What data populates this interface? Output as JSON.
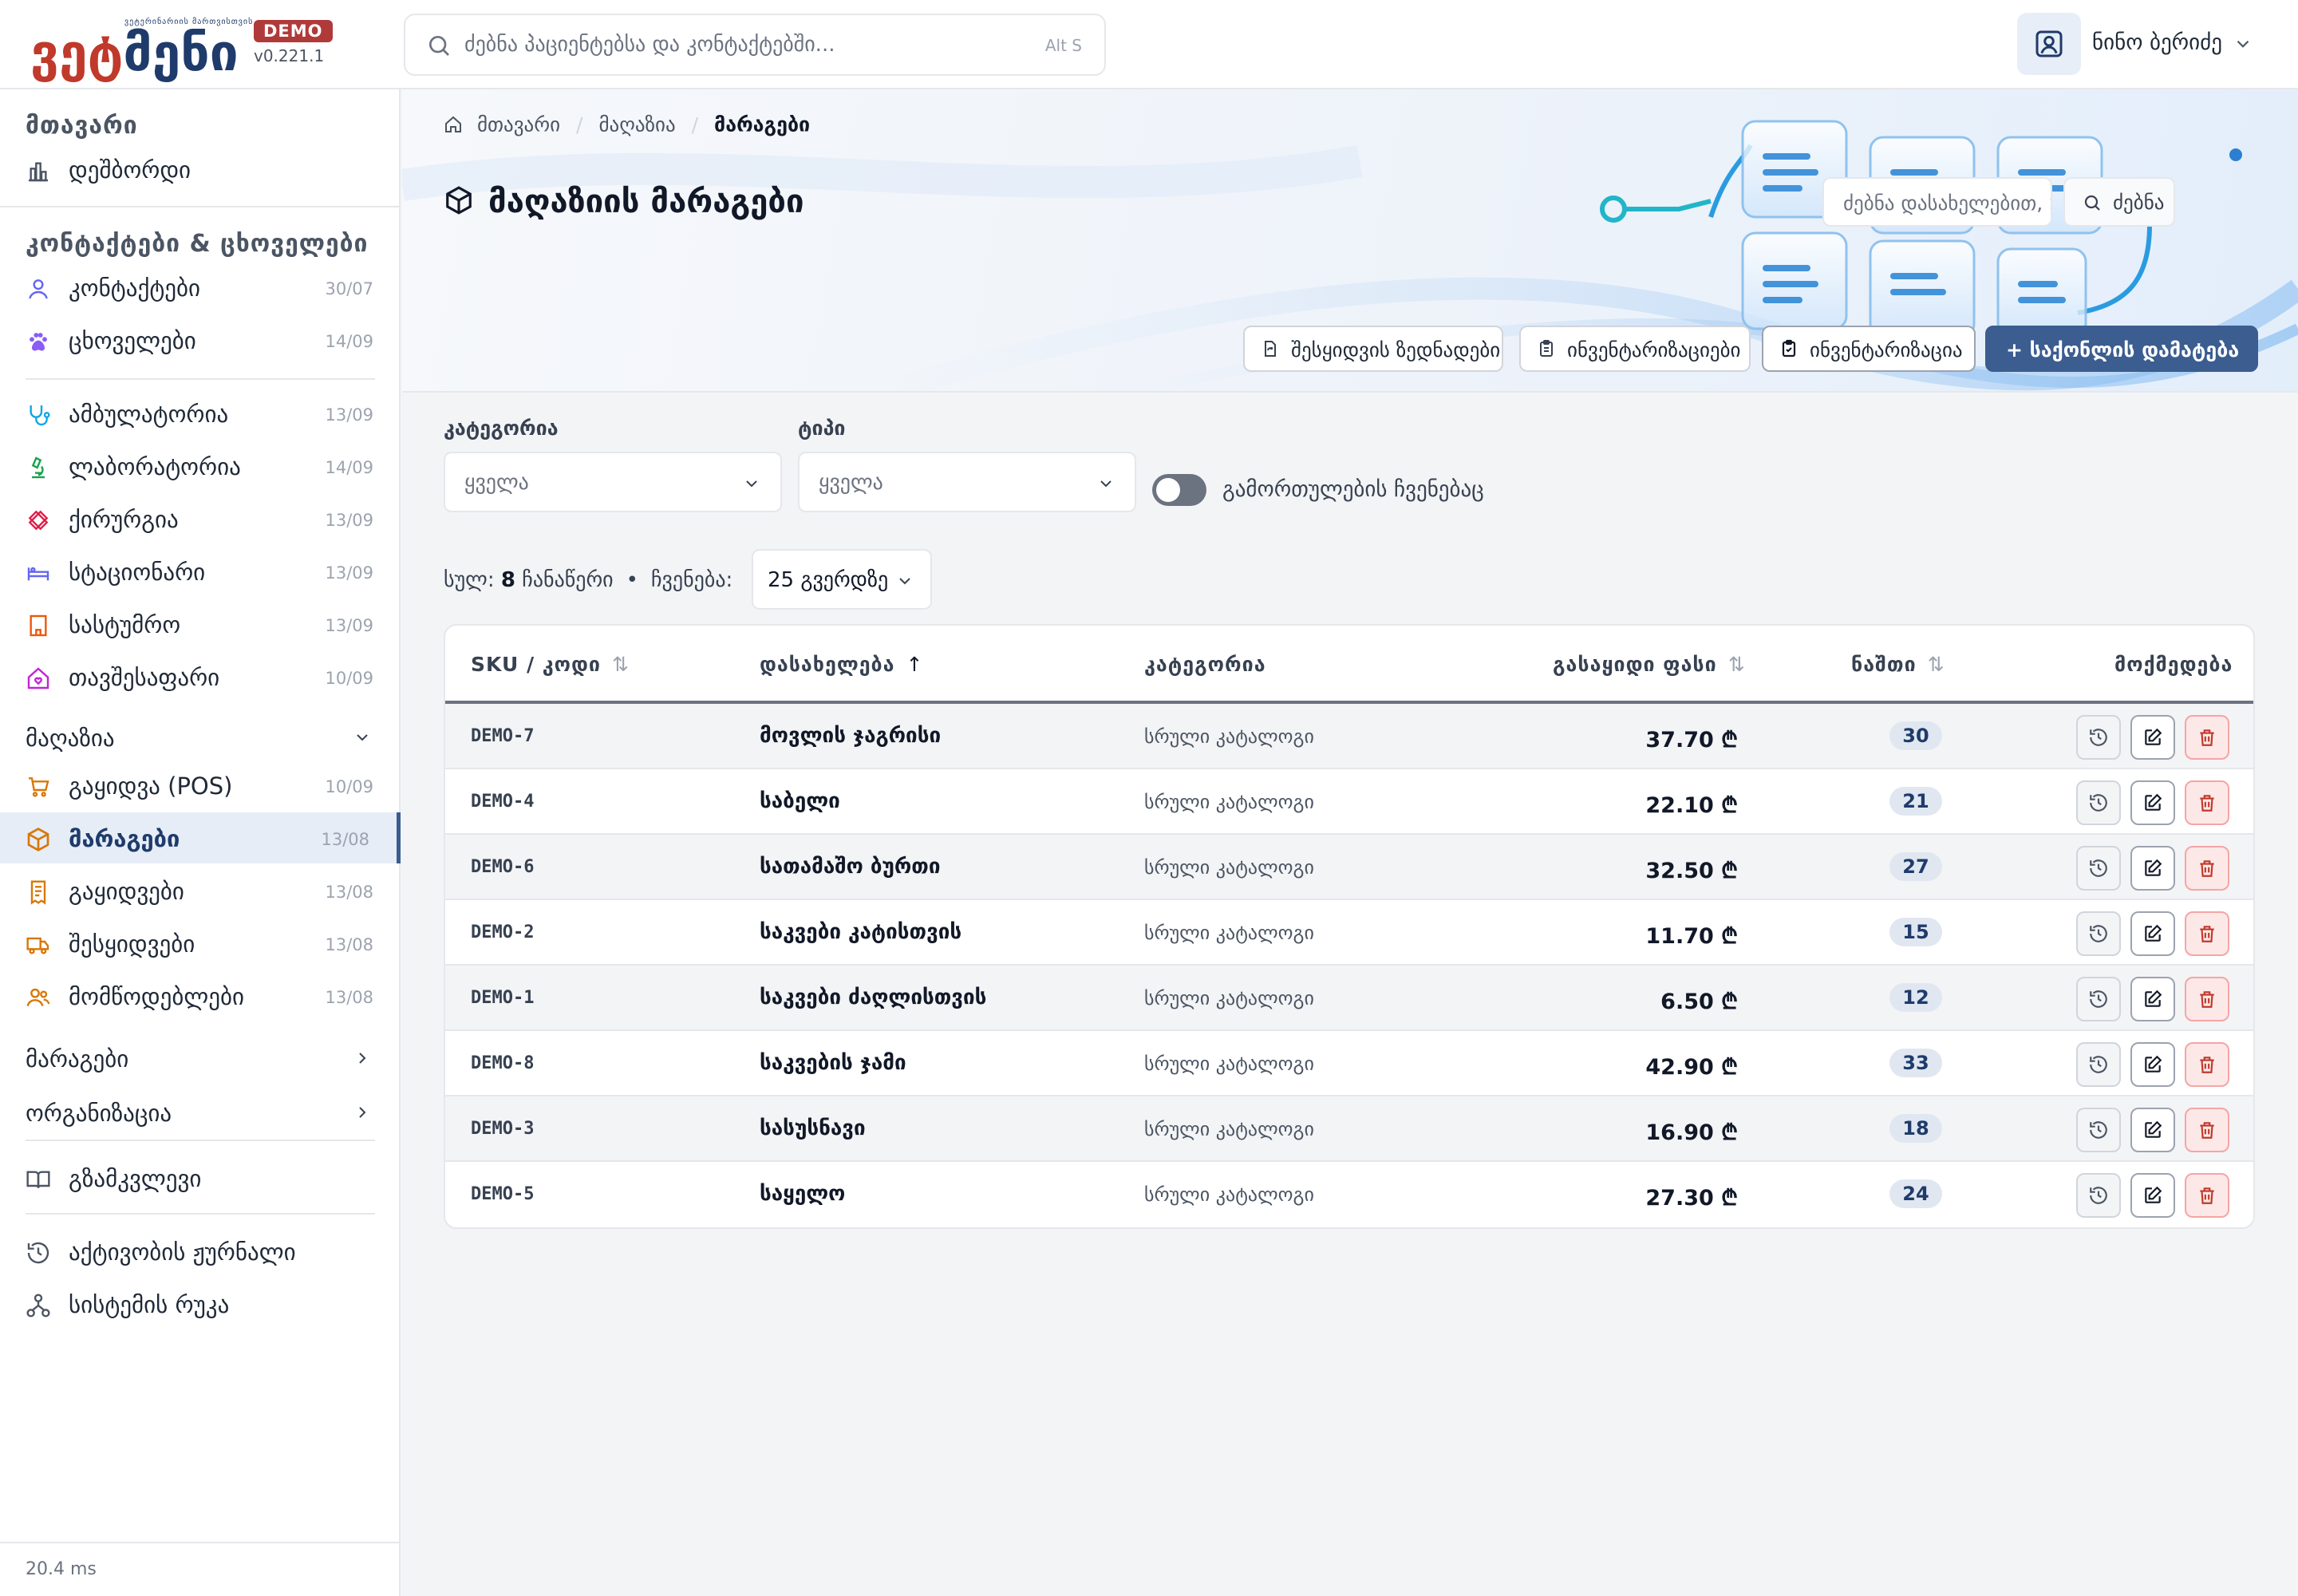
{
  "app": {
    "logo_text_part1": "ვეტ",
    "logo_text_part2": "მენი",
    "logo_tagline": "ვეტერინარიის მართვისთვის",
    "badge": "DEMO",
    "version": "v0.221.1"
  },
  "search": {
    "placeholder": "ძებნა პაციენტებსა და კონტაქტებში...",
    "shortcut": "Alt S"
  },
  "user": {
    "name": "ნინო ბერიძე"
  },
  "sidebar": {
    "sec_main": "მთავარი",
    "dashboard": "დეშბორდი",
    "sec_contacts": "კონტაქტები & ცხოველები",
    "items": [
      {
        "label": "კონტაქტები",
        "date": "30/07"
      },
      {
        "label": "ცხოველები",
        "date": "14/09"
      },
      {
        "label": "ამბულატორია",
        "date": "13/09"
      },
      {
        "label": "ლაბორატორია",
        "date": "14/09"
      },
      {
        "label": "ქირურგია",
        "date": "13/09"
      },
      {
        "label": "სტაციონარი",
        "date": "13/09"
      },
      {
        "label": "სასტუმრო",
        "date": "13/09"
      },
      {
        "label": "თავშესაფარი",
        "date": "10/09"
      }
    ],
    "group_shop": "მაღაზია",
    "shop_items": [
      {
        "label": "გაყიდვა (POS)",
        "date": "10/09"
      },
      {
        "label": "მარაგები",
        "date": "13/08"
      },
      {
        "label": "გაყიდვები",
        "date": "13/08"
      },
      {
        "label": "შესყიდვები",
        "date": "13/08"
      },
      {
        "label": "მომწოდებლები",
        "date": "13/08"
      }
    ],
    "group_stock": "მარაგები",
    "group_org": "ორგანიზაცია",
    "guide": "გზამკვლევი",
    "activity": "აქტივობის ჟურნალი",
    "system_map": "სისტემის რუკა",
    "footer": "20.4 ms"
  },
  "breadcrumb": {
    "home": "მთავარი",
    "shop": "მაღაზია",
    "current": "მარაგები"
  },
  "page": {
    "title": "მაღაზიის მარაგები",
    "search_placeholder": "ძებნა დასახელებით, SKU-",
    "search_button": "ძებნა",
    "btn_purchase_orders": "შესყიდვის ზედნადები",
    "btn_inventories": "ინვენტარიზაციები",
    "btn_inventory": "ინვენტარიზაცია",
    "btn_add": "+ საქონლის დამატება"
  },
  "filters": {
    "category_label": "კატეგორია",
    "category_value": "ყველა",
    "type_label": "ტიპი",
    "type_value": "ყველა",
    "toggle_label": "გამორთულების ჩვენებაც"
  },
  "summary": {
    "total_label": "სულ:",
    "total_count": "8",
    "records": "ჩანაწერი",
    "dot": "•",
    "show_label": "ჩვენება:",
    "per_page": "25 გვერდზე"
  },
  "table": {
    "headers": {
      "sku": "SKU / კოდი",
      "name": "დასახელება",
      "category": "კატეგორია",
      "price": "გასაყიდი ფასი",
      "stock": "ნაშთი",
      "actions": "მოქმედება"
    },
    "sort_idle": "⇅",
    "sort_up": "↑",
    "rows": [
      {
        "sku": "DEMO-7",
        "name": "მოვლის ჯაგრისი",
        "category": "სრული კატალოგი",
        "price": "37.70 ₾",
        "stock": "30"
      },
      {
        "sku": "DEMO-4",
        "name": "საბელი",
        "category": "სრული კატალოგი",
        "price": "22.10 ₾",
        "stock": "21"
      },
      {
        "sku": "DEMO-6",
        "name": "სათამაშო ბურთი",
        "category": "სრული კატალოგი",
        "price": "32.50 ₾",
        "stock": "27"
      },
      {
        "sku": "DEMO-2",
        "name": "საკვები კატისთვის",
        "category": "სრული კატალოგი",
        "price": "11.70 ₾",
        "stock": "15"
      },
      {
        "sku": "DEMO-1",
        "name": "საკვები ძაღლისთვის",
        "category": "სრული კატალოგი",
        "price": "6.50 ₾",
        "stock": "12"
      },
      {
        "sku": "DEMO-8",
        "name": "საკვების ჯამი",
        "category": "სრული კატალოგი",
        "price": "42.90 ₾",
        "stock": "33"
      },
      {
        "sku": "DEMO-3",
        "name": "სასუსნავი",
        "category": "სრული კატალოგი",
        "price": "16.90 ₾",
        "stock": "18"
      },
      {
        "sku": "DEMO-5",
        "name": "საყელო",
        "category": "სრული კატალოგი",
        "price": "27.30 ₾",
        "stock": "24"
      }
    ]
  },
  "colors": {
    "accent": "#3b5d8f",
    "brand_red": "#c0392b",
    "brand_navy": "#1f3b6b",
    "danger": "#c0392b"
  }
}
